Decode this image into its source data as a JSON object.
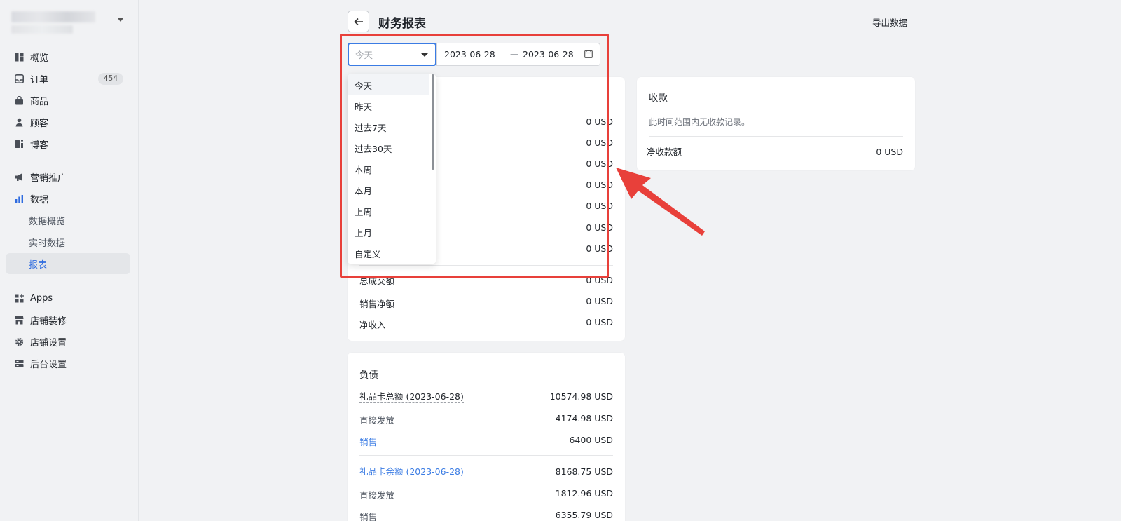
{
  "sidebar": {
    "items": [
      {
        "label": "概览",
        "icon": "overview-icon"
      },
      {
        "label": "订单",
        "icon": "inbox-icon",
        "badge": "454"
      },
      {
        "label": "商品",
        "icon": "bag-icon"
      },
      {
        "label": "顾客",
        "icon": "person-icon"
      },
      {
        "label": "博客",
        "icon": "blog-icon"
      },
      {
        "label": "营销推广",
        "icon": "megaphone-icon"
      },
      {
        "label": "数据",
        "icon": "bar-chart-icon"
      },
      {
        "label": "数据概览"
      },
      {
        "label": "实时数据"
      },
      {
        "label": "报表"
      },
      {
        "label": "Apps",
        "icon": "apps-icon"
      },
      {
        "label": "店铺装修",
        "icon": "store-icon"
      },
      {
        "label": "店铺设置",
        "icon": "gear-icon"
      },
      {
        "label": "后台设置",
        "icon": "server-icon"
      }
    ]
  },
  "header": {
    "title": "财务报表",
    "export_label": "导出数据"
  },
  "filters": {
    "range_value": "今天",
    "date_start": "2023-06-28",
    "date_separator": "—",
    "date_end": "2023-06-28"
  },
  "dropdown": {
    "options": [
      "今天",
      "昨天",
      "过去7天",
      "过去30天",
      "本周",
      "本月",
      "上周",
      "上月",
      "自定义"
    ],
    "selected_index": 0
  },
  "sales": {
    "hidden_values": [
      "0 USD",
      "0 USD",
      "0 USD",
      "0 USD",
      "0 USD",
      "0 USD",
      "0 USD"
    ],
    "totals": [
      {
        "label": "总成交额",
        "value": "0 USD"
      },
      {
        "label": "销售净额",
        "value": "0 USD"
      },
      {
        "label": "净收入",
        "value": "0 USD"
      }
    ]
  },
  "payments": {
    "title": "收款",
    "empty_text": "此时间范围内无收款记录。",
    "net_label": "净收款额",
    "net_value": "0 USD"
  },
  "liabilities": {
    "title": "负债",
    "rows": [
      {
        "label": "礼品卡总额 (2023-06-28)",
        "value": "10574.98 USD"
      },
      {
        "label": "直接发放",
        "value": "4174.98 USD"
      },
      {
        "label": "销售",
        "value": "6400 USD"
      },
      {
        "label": "礼品卡余额 (2023-06-28)",
        "value": "8168.75 USD"
      },
      {
        "label": "直接发放",
        "value": "1812.96 USD"
      },
      {
        "label": "销售",
        "value": "6355.79 USD"
      }
    ]
  },
  "colors": {
    "accent": "#3b7ce4",
    "annotation": "#e8403a"
  }
}
